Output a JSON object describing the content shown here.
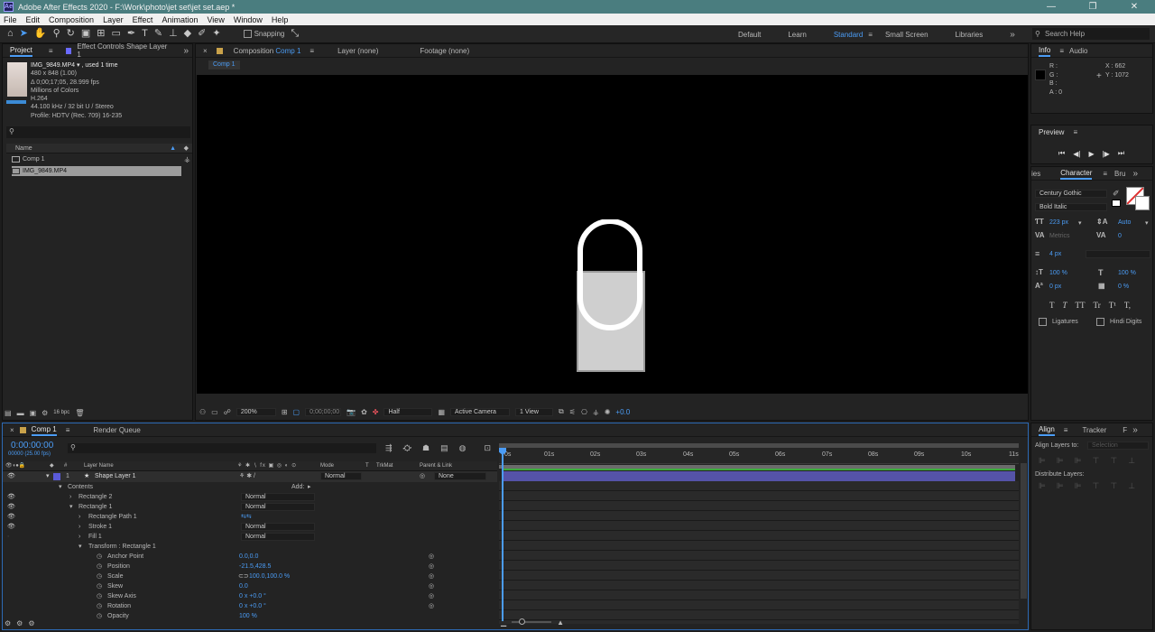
{
  "app": {
    "title": "Adobe After Effects 2020 - F:\\Work\\photo\\jet set\\jet set.aep *",
    "icon_text": "Ae",
    "win_min": "—",
    "win_max": "❐",
    "win_close": "✕"
  },
  "menu": [
    "File",
    "Edit",
    "Composition",
    "Layer",
    "Effect",
    "Animation",
    "View",
    "Window",
    "Help"
  ],
  "toolbar": {
    "snapping": "Snapping",
    "workspaces": [
      "Default",
      "Learn",
      "Standard",
      "Small Screen",
      "Libraries"
    ],
    "search_placeholder": "Search Help",
    "more": "»"
  },
  "project": {
    "tab_project": "Project",
    "tab_effect": "Effect Controls Shape Layer 1",
    "footage": {
      "name": "IMG_9849.MP4 ▾ , used 1 time",
      "dims": "480 x 848 (1.00)",
      "duration": "Δ 0;00;17;05, 28.999 fps",
      "colors": "Millions of Colors",
      "codec": "H.264",
      "audio": "44.100 kHz / 32 bit U / Stereo",
      "profile": "Profile: HDTV (Rec. 709) 16-235"
    },
    "col_name": "Name",
    "items": [
      {
        "name": "Comp 1"
      },
      {
        "name": "IMG_9849.MP4"
      }
    ],
    "bpc": "16 bpc"
  },
  "composition": {
    "tab_comp": "Composition",
    "tab_comp_name": "Comp 1",
    "tab_layer": "Layer (none)",
    "tab_footage": "Footage (none)",
    "subtab": "Comp 1",
    "zoom": "200%",
    "timecode": "0;00;00;00",
    "resolution": "Half",
    "camera": "Active Camera",
    "views": "1 View",
    "exposure": "+0.0"
  },
  "info": {
    "tab_info": "Info",
    "tab_audio": "Audio",
    "r": "R :",
    "g": "G :",
    "b": "B :",
    "a": "A :  0",
    "x": "X : 662",
    "y": "Y : 1072"
  },
  "preview": {
    "title": "Preview"
  },
  "character": {
    "tab_prev": "ies",
    "tab": "Character",
    "tab_next": "Bru",
    "font": "Century Gothic",
    "style": "Bold Italic",
    "size": "223 px",
    "leading": "Auto",
    "kerning": "Metrics",
    "tracking": "0",
    "stroke": "4 px",
    "vscale": "100 %",
    "hscale": "100 %",
    "baseline": "0 px",
    "tsume": "0 %",
    "ligatures": "Ligatures",
    "hindi": "Hindi Digits",
    "style_buttons": [
      "T",
      "T",
      "TT",
      "Tr",
      "T¹",
      "T,"
    ]
  },
  "align": {
    "tab": "Align",
    "tab2": "Tracker",
    "tab3": "F",
    "align_to": "Align Layers to:",
    "selection": "Selection",
    "distribute": "Distribute Layers:"
  },
  "timeline": {
    "tab_comp": "Comp 1",
    "tab_render": "Render Queue",
    "timecode": "0:00:00:00",
    "fps": "00000 (25.00 fps)",
    "headers": {
      "num": "#",
      "layer_name": "Layer Name",
      "mode": "Mode",
      "t": "T",
      "trkmat": "TrkMat",
      "parent": "Parent & Link"
    },
    "ruler": [
      "0s",
      "01s",
      "02s",
      "03s",
      "04s",
      "05s",
      "06s",
      "07s",
      "08s",
      "09s",
      "10s",
      "11s"
    ],
    "layer": {
      "num": "1",
      "name": "Shape Layer 1",
      "mode": "Normal",
      "parent": "None"
    },
    "add_label": "Add:",
    "props": [
      {
        "label": "Contents",
        "indent": 0,
        "twirl": "▾"
      },
      {
        "label": "Rectangle 2",
        "indent": 1,
        "twirl": "›",
        "mode": "Normal",
        "eye": true
      },
      {
        "label": "Rectangle 1",
        "indent": 1,
        "twirl": "▾",
        "mode": "Normal",
        "eye": true
      },
      {
        "label": "Rectangle Path 1",
        "indent": 2,
        "twirl": "›",
        "eye": true
      },
      {
        "label": "Stroke 1",
        "indent": 2,
        "twirl": "›",
        "mode": "Normal",
        "eye": true
      },
      {
        "label": "Fill 1",
        "indent": 2,
        "twirl": "›",
        "mode": "Normal",
        "eye": true
      },
      {
        "label": "Transform : Rectangle 1",
        "indent": 2,
        "twirl": "▾"
      },
      {
        "label": "Anchor Point",
        "indent": 3,
        "stop": true,
        "value": "0.0,0.0"
      },
      {
        "label": "Position",
        "indent": 3,
        "stop": true,
        "value": "-21.5,428.5"
      },
      {
        "label": "Scale",
        "indent": 3,
        "stop": true,
        "value": "100.0,100.0 %",
        "link": true
      },
      {
        "label": "Skew",
        "indent": 3,
        "stop": true,
        "value": "0.0"
      },
      {
        "label": "Skew Axis",
        "indent": 3,
        "stop": true,
        "value": "0 x +0.0 °"
      },
      {
        "label": "Rotation",
        "indent": 3,
        "stop": true,
        "value": "0 x +0.0 °"
      },
      {
        "label": "Opacity",
        "indent": 3,
        "stop": true,
        "value": "100 %"
      }
    ]
  }
}
